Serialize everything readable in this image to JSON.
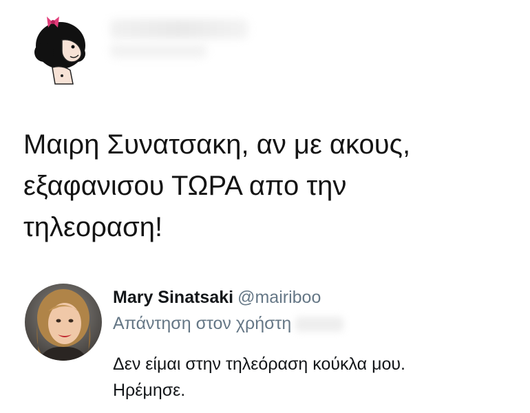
{
  "tweet": {
    "text_lines": [
      "Μαιρη Συνατσακη, αν με ακους,",
      "εξαφανισου ΤΩΡΑ απο την",
      "τηλεοραση!"
    ]
  },
  "reply": {
    "author_name": "Mary Sinatsaki",
    "author_handle": "@mairiboo",
    "replying_to": "Απάντηση στον χρήστη",
    "text_lines": [
      "Δεν είμαι στην τηλεόραση κούκλα μου.",
      "Ηρέμησε."
    ]
  },
  "colors": {
    "text": "#14171a",
    "secondary": "#657786",
    "background": "#ffffff"
  },
  "icons": {
    "avatar_1": "cartoon-girl-avatar",
    "avatar_2": "profile-photo-avatar"
  }
}
